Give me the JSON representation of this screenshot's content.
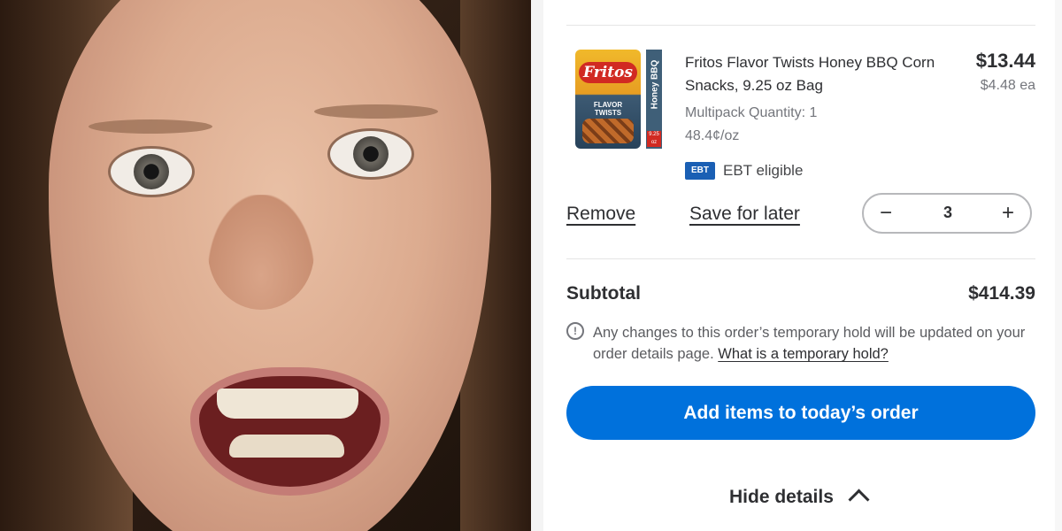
{
  "colors": {
    "primary_button": "#0071dc",
    "ebt_badge": "#1a5fb4",
    "text": "#2e2f32",
    "muted": "#74767c"
  },
  "product": {
    "image_icon": "fritos-bag-image",
    "title": "Fritos Flavor Twists Honey BBQ Corn Snacks, 9.25 oz Bag",
    "price": "$13.44",
    "unit_price": "$4.48 ea",
    "multipack": "Multipack Quantity: 1",
    "price_per_oz": "48.4¢/oz",
    "ebt_badge": "EBT",
    "ebt_label": "EBT eligible",
    "package_brand": "Fritos",
    "package_flavor": "Honey BBQ",
    "package_twists": "FLAVOR TWISTS",
    "package_size": "9.25 oz"
  },
  "actions": {
    "remove": "Remove",
    "save_for_later": "Save for later"
  },
  "quantity": {
    "value": "3",
    "minus_icon": "minus-icon",
    "plus_icon": "plus-icon"
  },
  "summary": {
    "subtotal_label": "Subtotal",
    "subtotal_value": "$414.39"
  },
  "notice": {
    "icon": "info-icon",
    "text": "Any changes to this order’s temporary hold will be updated on your order details page. ",
    "link": "What is a temporary hold?"
  },
  "cta": {
    "label": "Add items to today’s order"
  },
  "details_toggle": {
    "label": "Hide details",
    "icon": "chevron-up-icon"
  }
}
